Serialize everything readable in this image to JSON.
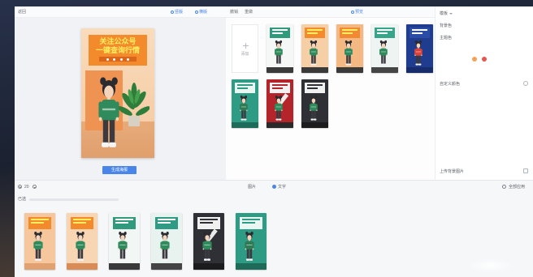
{
  "topbar": {
    "back_label": "返回",
    "tabs": [
      {
        "label": "竖版"
      },
      {
        "label": "横版"
      }
    ],
    "undo_label": "撤销",
    "redo_label": "重做",
    "preview_label": "预览"
  },
  "preview": {
    "poster": {
      "title_line1": "关注公众号",
      "title_line2": "一键查询行情"
    },
    "generate_label": "生成海报"
  },
  "templates": {
    "add_label": "添加",
    "items": [
      {
        "bg": "#f4f7f6",
        "header": "#2f9a7c",
        "title_color": "#ffffff",
        "figure": "#2f8a5c",
        "footer": "#3a3a3a"
      },
      {
        "bg": "#f7cfa6",
        "header": "#f38a2c",
        "title_color": "#ffef5e",
        "figure": "#2f8a5c",
        "footer": "#3a3a3a"
      },
      {
        "bg": "#f4b983",
        "header": "#f28a33",
        "title_color": "#ffef5e",
        "figure": "#2f8a5c",
        "footer": "#3a3a3a"
      },
      {
        "bg": "#eef4f2",
        "header": "#37a589",
        "title_color": "#ffffff",
        "figure": "#2f8a5c",
        "footer": "#454545"
      },
      {
        "bg": "#1f3c8f",
        "header": "#2a4ca6",
        "title_color": "#ffffff",
        "figure": "#d9433a",
        "footer": "#172d6b"
      },
      {
        "bg": "#2e9c84",
        "header": "#e9f6f2",
        "title_color": "#2e9c84",
        "figure": "#2f7a55",
        "footer": "#1f6b5a"
      },
      {
        "bg": "#b3252b",
        "header": "#f2f2f2",
        "title_color": "#b3252b",
        "figure": "#2f8a5c",
        "footer": "#2a2a2a",
        "accent": "#ffffff"
      },
      {
        "bg": "#2f3035",
        "header": "#f0f0f0",
        "title_color": "#2f3035",
        "figure": "#2f8a5c",
        "footer": "#1c1c1f"
      }
    ]
  },
  "settings": {
    "template_label": "模板",
    "background_label": "背景色",
    "theme_label": "主题色",
    "swatches": [
      "#f3a25a",
      "#e8554e"
    ],
    "custom_color_label": "自定义颜色",
    "upload_background_label": "上传背景图片"
  },
  "bottom": {
    "zoom_value": "20",
    "image_label": "图片",
    "text_label": "文字",
    "apply_all_label": "全部应用",
    "selected_label": "已选",
    "results": [
      {
        "bg": "#f6c69c",
        "header": "#f38a2c",
        "title_color": "#ffef5e",
        "figure": "#2f8a5c",
        "footer": "#e2a170"
      },
      {
        "bg": "#f8d6b4",
        "header": "#f38a2c",
        "title_color": "#ffef5e",
        "figure": "#2f8a5c",
        "footer": "#d98c55"
      },
      {
        "bg": "#f2f6f5",
        "header": "#2f9a7c",
        "title_color": "#ffffff",
        "figure": "#2f8a5c",
        "footer": "#3a3a3a"
      },
      {
        "bg": "#e8f3f0",
        "header": "#2e9c84",
        "title_color": "#ffffff",
        "figure": "#2f8a5c",
        "footer": "#444444"
      },
      {
        "bg": "#2f3035",
        "header": "#f0f0f0",
        "title_color": "#2f3035",
        "figure": "#2f8a5c",
        "footer": "#1c1c1f",
        "accent": "#ffffff"
      },
      {
        "bg": "#2e9c84",
        "header": "#e9f6f2",
        "title_color": "#2e9c84",
        "figure": "#2f7a55",
        "footer": "#1f6b5a"
      }
    ]
  },
  "colors": {
    "accent": "#4a86e8",
    "poster_orange": "#f38a2c",
    "poster_title": "#ffef5e"
  }
}
